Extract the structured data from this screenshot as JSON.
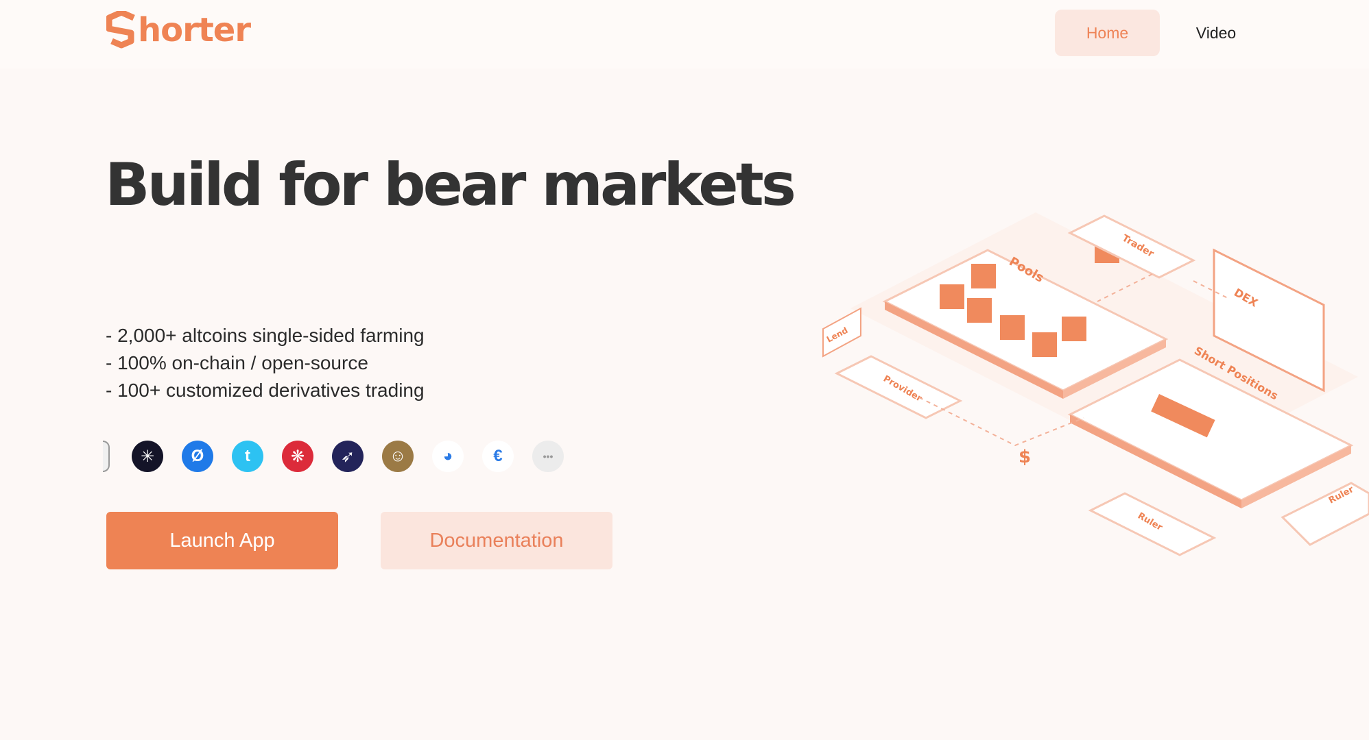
{
  "header": {
    "logo_text": "horter",
    "nav": {
      "home_label": "Home",
      "video_label": "Video"
    }
  },
  "hero": {
    "title": "Build for bear markets",
    "features": [
      "- 2,000+ altcoins single-sided farming",
      "- 100% on-chain / open-source",
      "- 100+ customized derivatives trading"
    ],
    "coins": [
      {
        "icon": "partial-coin-icon",
        "color": "#f0f0f0",
        "glyph": ""
      },
      {
        "icon": "grid-coin-icon",
        "color": "#141428",
        "glyph": "✳"
      },
      {
        "icon": "slash-coin-icon",
        "color": "#1f7ae8",
        "glyph": "Ø"
      },
      {
        "icon": "t-coin-icon",
        "color": "#2dc2f2",
        "glyph": "t"
      },
      {
        "icon": "flower-coin-icon",
        "color": "#dc2b3a",
        "glyph": "❋"
      },
      {
        "icon": "rocket-coin-icon",
        "color": "#23245a",
        "glyph": "➶"
      },
      {
        "icon": "portrait-coin-icon",
        "color": "#9b7a45",
        "glyph": "☺"
      },
      {
        "icon": "bubble-coin-icon",
        "color": "#ffffff",
        "glyph": "◕"
      },
      {
        "icon": "e-coin-icon",
        "color": "#ffffff",
        "glyph": "€"
      },
      {
        "icon": "more-dots-icon",
        "color": "#ececec",
        "glyph": "•••"
      }
    ],
    "launch_label": "Launch App",
    "docs_label": "Documentation"
  },
  "illustration": {
    "labels": {
      "pools": "Pools",
      "trader": "Trader",
      "dex": "DEX",
      "lend": "Lend",
      "provider": "Provider",
      "short_positions": "Short Positions",
      "ruler_1": "Ruler",
      "ruler_2": "Ruler"
    }
  },
  "colors": {
    "accent": "#ee8354",
    "accent_light": "#fbe5dd",
    "background": "#fdf8f6"
  }
}
